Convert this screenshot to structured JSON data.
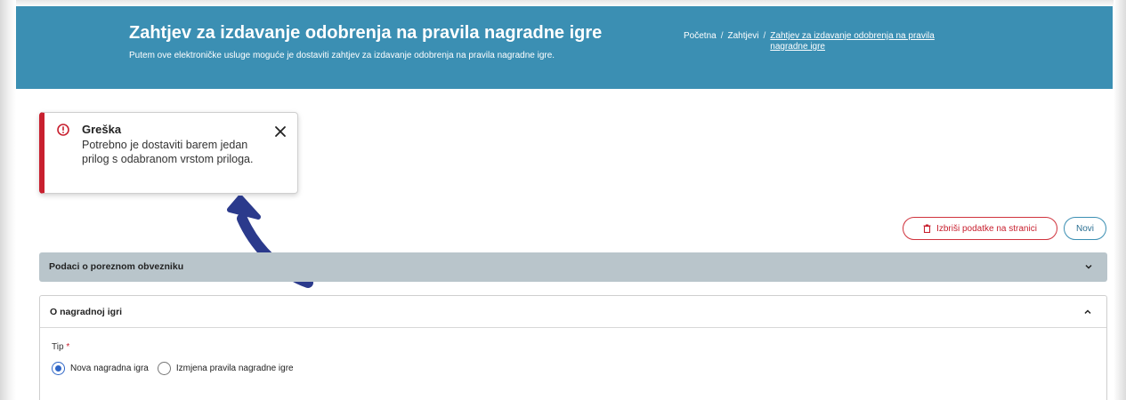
{
  "header": {
    "title": "Zahtjev za izdavanje odobrenja na pravila nagradne igre",
    "subtitle": "Putem ove elektroničke usluge moguće je dostaviti zahtjev za izdavanje odobrenja na pravila nagradne igre.",
    "background_color": "#3b8fb3"
  },
  "breadcrumb": {
    "items": [
      "Početna",
      "Zahtjevi"
    ],
    "separator": "/",
    "current": "Zahtjev za izdavanje odobrenja na pravila nagradne igre"
  },
  "toast": {
    "title": "Greška",
    "message": "Potrebno je dostaviti barem jedan prilog s odabranom vrstom priloga.",
    "icon": "error-circle-icon",
    "accent_color": "#c8202f"
  },
  "actions": {
    "delete_label": "Izbriši podatke na stranici",
    "new_label": "Novi"
  },
  "panels": {
    "taxpayer": {
      "title": "Podaci o poreznom obvezniku",
      "expanded": false
    },
    "game": {
      "title": "O nagradnoj igri",
      "expanded": true,
      "type_label": "Tip",
      "required_marker": "*",
      "options": [
        {
          "label": "Nova nagradna igra",
          "selected": true
        },
        {
          "label": "Izmjena pravila nagradne igre",
          "selected": false
        }
      ]
    }
  },
  "annotation_color": "#2b3a8c"
}
